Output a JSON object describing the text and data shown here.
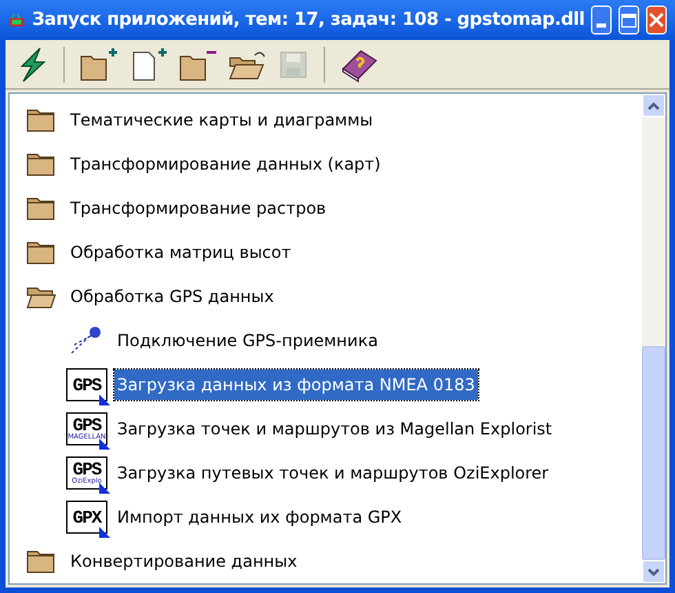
{
  "window": {
    "title": "Запуск приложений, тем: 17, задач: 108 - gpstomap.dll"
  },
  "toolbar": [
    {
      "kind": "run",
      "disabled": false
    },
    {
      "kind": "sep"
    },
    {
      "kind": "folder-add",
      "disabled": false
    },
    {
      "kind": "doc-add",
      "disabled": false
    },
    {
      "kind": "folder-remove",
      "disabled": false
    },
    {
      "kind": "folder-open",
      "disabled": false
    },
    {
      "kind": "save",
      "disabled": true
    },
    {
      "kind": "sep"
    },
    {
      "kind": "help",
      "disabled": false
    }
  ],
  "tree": [
    {
      "label": "Тематические карты и диаграммы",
      "expanded": false
    },
    {
      "label": "Трансформирование данных (карт)",
      "expanded": false
    },
    {
      "label": "Трансформирование растров",
      "expanded": false
    },
    {
      "label": "Обработка матриц высот",
      "expanded": false
    },
    {
      "label": "Обработка GPS данных",
      "expanded": true,
      "children": [
        {
          "label": "Подключение GPS-приемника",
          "kind": "receiver",
          "selected": false
        },
        {
          "label": "Загрузка данных из формата NMEA 0183",
          "kind": "badge",
          "icon_text": "GPS",
          "selected": true
        },
        {
          "label": "Загрузка точек и маршрутов из Magellan Explorist",
          "kind": "badge",
          "icon_text": "GPS",
          "icon_subtext": "MAGELLAN",
          "selected": false
        },
        {
          "label": "Загрузка путевых точек и маршрутов OziExplorer",
          "kind": "badge",
          "icon_text": "GPS",
          "icon_subtext": "OziExplo",
          "selected": false
        },
        {
          "label": "Импорт данных их формата GPX",
          "kind": "badge",
          "icon_text": "GPX",
          "selected": false
        }
      ]
    },
    {
      "label": "Конвертирование данных",
      "expanded": false
    }
  ]
}
